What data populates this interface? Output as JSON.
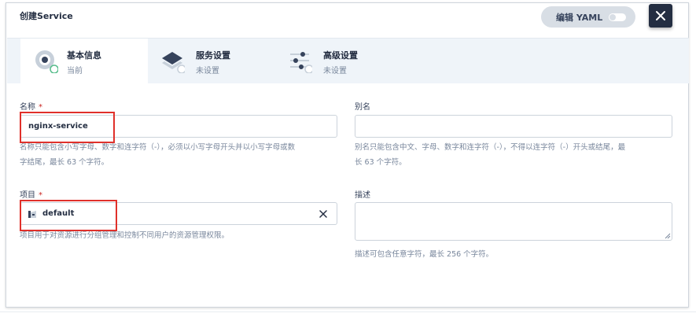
{
  "header": {
    "title": "创建Service",
    "yaml_toggle_label": "编辑 YAML"
  },
  "steps": [
    {
      "title": "基本信息",
      "status": "当前",
      "icon": "basic-info-icon"
    },
    {
      "title": "服务设置",
      "status": "未设置",
      "icon": "layers-icon"
    },
    {
      "title": "高级设置",
      "status": "未设置",
      "icon": "sliders-icon"
    }
  ],
  "form": {
    "name": {
      "label": "名称",
      "required_mark": "*",
      "value": "nginx-service",
      "hint_line1": "名称只能包含小写字母、数字和连字符（-），必须以小写字母开头并以小写字母或数",
      "hint_line2": "字结尾，最长 63 个字符。"
    },
    "alias": {
      "label": "别名",
      "value": "",
      "hint_line1": "别名只能包含中文、字母、数字和连字符（-），不得以连字符（-）开头或结尾，最",
      "hint_line2": "长 63 个字符。"
    },
    "project": {
      "label": "项目",
      "required_mark": "*",
      "value": "default",
      "hint": "项目用于对资源进行分组管理和控制不同用户的资源管理权限。"
    },
    "description": {
      "label": "描述",
      "value": "",
      "hint": "描述可包含任意字符，最长 256 个字符。"
    }
  },
  "colors": {
    "accent_dark": "#242e42",
    "highlight_red": "#e0302a",
    "success_green": "#55bc8a",
    "step_bar_bg": "#eff4f9"
  }
}
